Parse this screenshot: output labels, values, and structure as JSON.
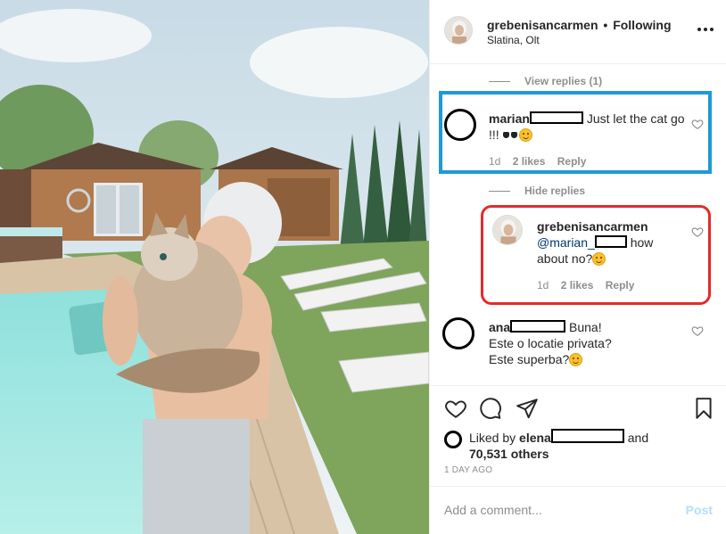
{
  "post": {
    "username": "grebenisancarmen",
    "separator": "•",
    "follow_status": "Following",
    "location": "Slatina, Olt"
  },
  "comments": {
    "view_replies": "View replies (1)",
    "hide_replies": "Hide replies",
    "marian": {
      "username": "marian",
      "text": "Just let the cat go",
      "text2": "!!!",
      "time": "1d",
      "likes": "2 likes",
      "reply": "Reply"
    },
    "author_reply": {
      "username": "grebenisancarmen",
      "mention": "@marian_",
      "text": "how",
      "text2": "about no?",
      "time": "1d",
      "likes": "2 likes",
      "reply": "Reply"
    },
    "ana": {
      "username": "ana",
      "text": "Buna!",
      "line2": "Este o locatie privata?",
      "line3": "Este superba?"
    }
  },
  "actions": {
    "liked_by_prefix": "Liked by",
    "liked_by_user": "elena",
    "liked_by_and": "and",
    "others_count": "70,531 others",
    "timestamp": "1 DAY AGO"
  },
  "add_comment": {
    "placeholder": "Add a comment...",
    "post_label": "Post"
  },
  "colors": {
    "highlight_blue": "#1e9ad6",
    "highlight_red": "#e32b2b",
    "post_button_disabled": "#b2dffc",
    "mention": "#00376b",
    "muted": "#8e8e8e"
  },
  "icons": [
    "more-icon",
    "heart-icon",
    "comment-icon",
    "share-icon",
    "bookmark-icon"
  ]
}
